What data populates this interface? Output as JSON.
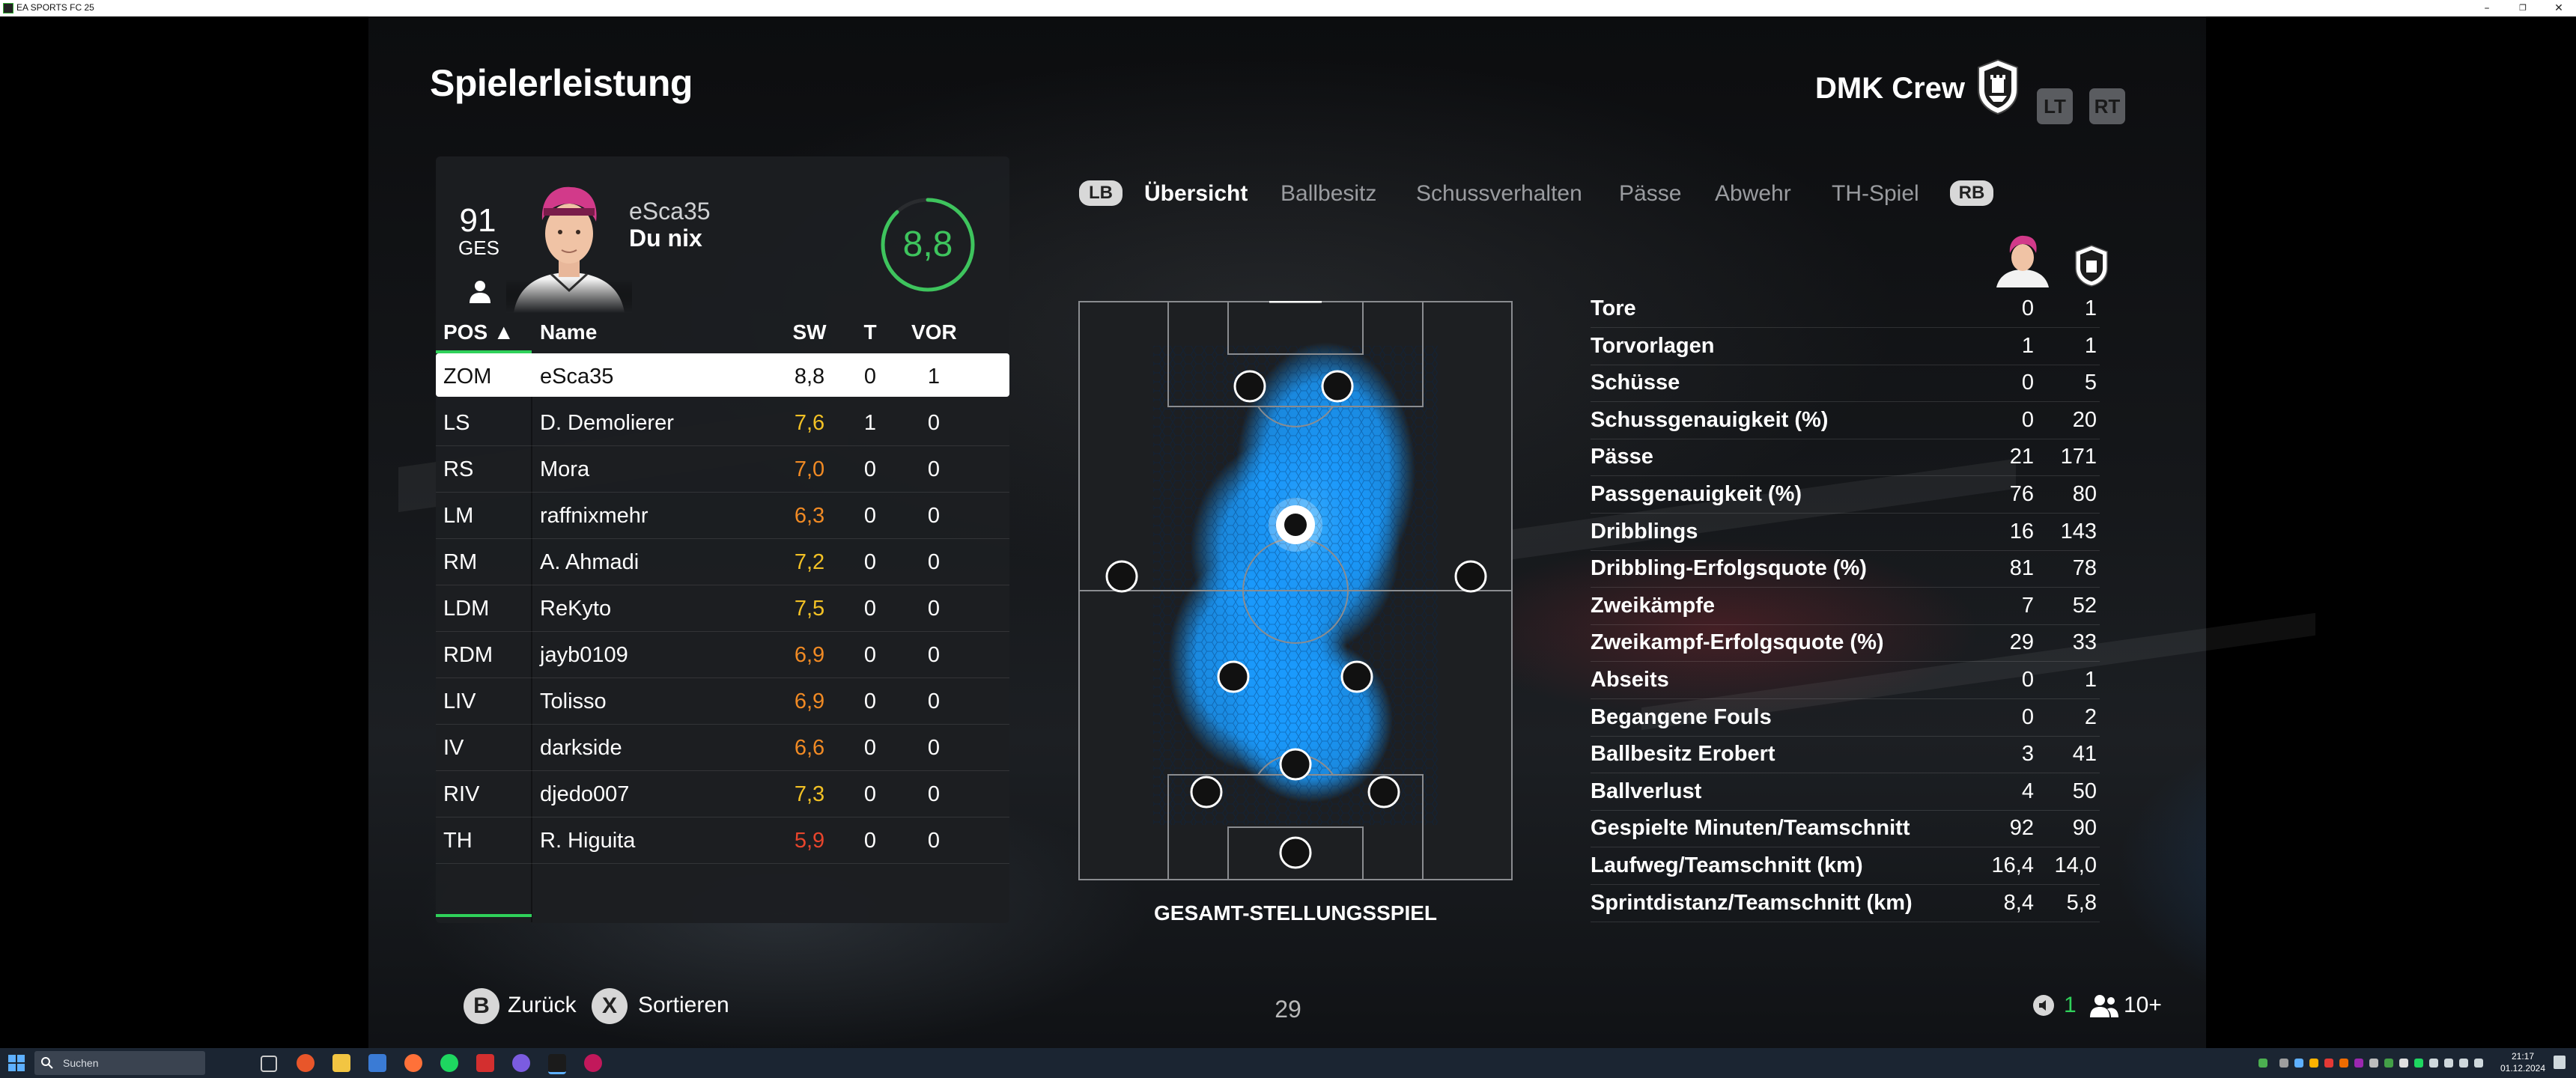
{
  "window": {
    "title": "EA SPORTS FC 25",
    "minimize": "–",
    "maximize": "❐",
    "close": "✕"
  },
  "header": {
    "title": "Spielerleistung",
    "team": "DMK Crew",
    "lt_label": "LT",
    "rt_label": "RT"
  },
  "player": {
    "overall": "91",
    "overall_label": "GES",
    "name": "eSca35",
    "club": "Du nix",
    "match_rating": "8,8",
    "match_rating_fraction": 0.88
  },
  "table": {
    "headers": {
      "pos": "POS ▲",
      "name": "Name",
      "sw": "SW",
      "t": "T",
      "vor": "VOR"
    },
    "rows": [
      {
        "pos": "ZOM",
        "name": "eSca35",
        "sw": "8,8",
        "t": "0",
        "vor": "1",
        "sw_color": "#111111",
        "selected": true
      },
      {
        "pos": "LS",
        "name": "D. Demolierer",
        "sw": "7,6",
        "t": "1",
        "vor": "0",
        "sw_color": "#f2c125"
      },
      {
        "pos": "RS",
        "name": "Mora",
        "sw": "7,0",
        "t": "0",
        "vor": "0",
        "sw_color": "#f08a24"
      },
      {
        "pos": "LM",
        "name": "raffnixmehr",
        "sw": "6,3",
        "t": "0",
        "vor": "0",
        "sw_color": "#f08a24"
      },
      {
        "pos": "RM",
        "name": "A. Ahmadi",
        "sw": "7,2",
        "t": "0",
        "vor": "0",
        "sw_color": "#f2c125"
      },
      {
        "pos": "LDM",
        "name": "ReKyto",
        "sw": "7,5",
        "t": "0",
        "vor": "0",
        "sw_color": "#f2c125"
      },
      {
        "pos": "RDM",
        "name": "jayb0109",
        "sw": "6,9",
        "t": "0",
        "vor": "0",
        "sw_color": "#f08a24"
      },
      {
        "pos": "LIV",
        "name": "Tolisso",
        "sw": "6,9",
        "t": "0",
        "vor": "0",
        "sw_color": "#f08a24"
      },
      {
        "pos": "IV",
        "name": "darkside",
        "sw": "6,6",
        "t": "0",
        "vor": "0",
        "sw_color": "#f08a24"
      },
      {
        "pos": "RIV",
        "name": "djedo007",
        "sw": "7,3",
        "t": "0",
        "vor": "0",
        "sw_color": "#f2c125"
      },
      {
        "pos": "TH",
        "name": "R. Higuita",
        "sw": "5,9",
        "t": "0",
        "vor": "0",
        "sw_color": "#e8452c"
      }
    ]
  },
  "tabs": {
    "lb": "LB",
    "rb": "RB",
    "items": [
      "Übersicht",
      "Ballbesitz",
      "Schussverhalten",
      "Pässe",
      "Abwehr",
      "TH-Spiel"
    ],
    "active_index": 0
  },
  "pitch": {
    "label": "GESAMT-STELLUNGSSPIEL",
    "heat_color": "#1a9bff"
  },
  "stats": [
    {
      "label": "Tore",
      "player": "0",
      "team": "1"
    },
    {
      "label": "Torvorlagen",
      "player": "1",
      "team": "1"
    },
    {
      "label": "Schüsse",
      "player": "0",
      "team": "5"
    },
    {
      "label": "Schussgenauigkeit (%)",
      "player": "0",
      "team": "20"
    },
    {
      "label": "Pässe",
      "player": "21",
      "team": "171"
    },
    {
      "label": "Passgenauigkeit (%)",
      "player": "76",
      "team": "80"
    },
    {
      "label": "Dribblings",
      "player": "16",
      "team": "143"
    },
    {
      "label": "Dribbling-Erfolgsquote (%)",
      "player": "81",
      "team": "78"
    },
    {
      "label": "Zweikämpfe",
      "player": "7",
      "team": "52"
    },
    {
      "label": "Zweikampf-Erfolgsquote (%)",
      "player": "29",
      "team": "33"
    },
    {
      "label": "Abseits",
      "player": "0",
      "team": "1"
    },
    {
      "label": "Begangene Fouls",
      "player": "0",
      "team": "2"
    },
    {
      "label": "Ballbesitz Erobert",
      "player": "3",
      "team": "41"
    },
    {
      "label": "Ballverlust",
      "player": "4",
      "team": "50"
    },
    {
      "label": "Gespielte Minuten/Teamschnitt",
      "player": "92",
      "team": "90"
    },
    {
      "label": "Laufweg/Teamschnitt (km)",
      "player": "16,4",
      "team": "14,0"
    },
    {
      "label": "Sprintdistanz/Teamschnitt (km)",
      "player": "8,4",
      "team": "5,8"
    }
  ],
  "footer": {
    "back_button": "B",
    "back_label": "Zurück",
    "sort_button": "X",
    "sort_label": "Sortieren",
    "page": "29",
    "friends_count": "1",
    "players_count": "10+"
  },
  "taskbar": {
    "search_placeholder": "Suchen",
    "time": "21:17",
    "date": "01.12.2024"
  },
  "colors": {
    "accent_green": "#2fd15a",
    "rating_green": "#3ec45d"
  }
}
